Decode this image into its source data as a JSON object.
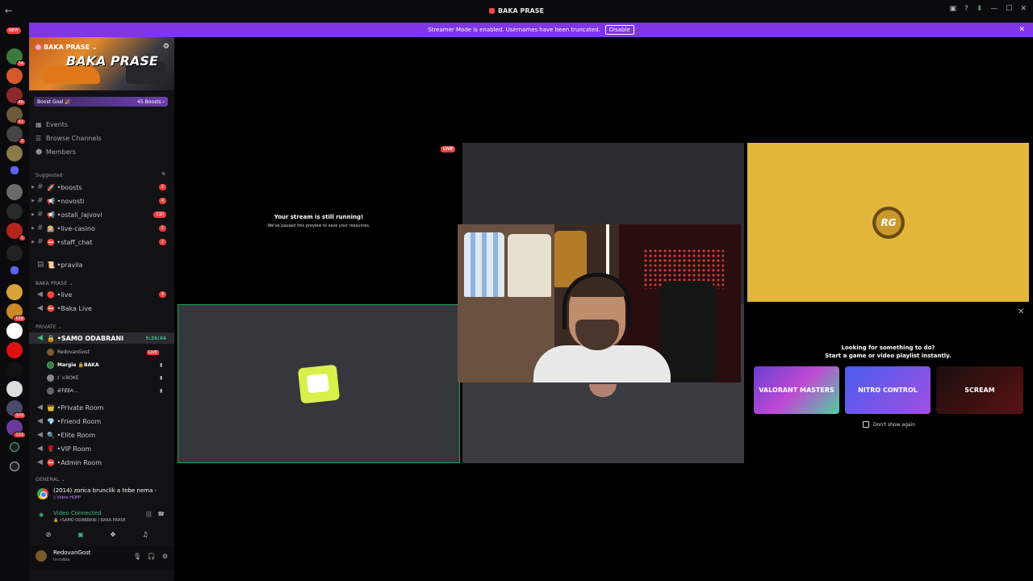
{
  "titlebar": {
    "back": "←",
    "title": "BAKA PRASE",
    "controls": [
      "▣",
      "?",
      "⬇",
      "—",
      "☐",
      "✕"
    ]
  },
  "banner": {
    "message": "Streamer Mode is enabled. Usernames have been truncated.",
    "button": "Disable",
    "close": "✕"
  },
  "rail": {
    "new_label": "NEW",
    "badges": [
      "34",
      "46",
      "41",
      "3",
      "1",
      "636",
      "303",
      "132"
    ]
  },
  "server": {
    "name": "BAKA PRASE ⌄",
    "banner_text": "BAKA PRASE",
    "boost_goal": "Boost Goal 🎉",
    "boost_count": "45 Boosts ›"
  },
  "nav": {
    "events": "Events",
    "browse": "Browse Channels",
    "members": "Members"
  },
  "sections": {
    "suggested": "Suggested",
    "baka_prase": "BAKA PRASE ⌄",
    "private": "PRIVATE ⌄",
    "general": "GENERAL ⌄"
  },
  "channels": {
    "suggested": [
      {
        "name": "🚀 •boosts",
        "count": "2"
      },
      {
        "name": "📢 •novosti",
        "count": "4"
      },
      {
        "name": "📢 •ostali_lajvovi",
        "count": "110"
      },
      {
        "name": "🎰 •live-casino",
        "count": "1"
      },
      {
        "name": "⛔ •staff_chat",
        "count": "2"
      }
    ],
    "rules": "📜 •pravila",
    "baka": [
      {
        "name": "🔴 •live",
        "count": "4"
      },
      {
        "name": "⛔ •Baka Live",
        "count": ""
      }
    ],
    "active": {
      "name": "🔒 •SAMO ODABRANI",
      "timer": "5:26:44"
    },
    "voice_users": [
      {
        "name": "RedovanGost",
        "live": "LIVE"
      },
      {
        "name": "Margie 🔒BAKA",
        "live": ""
      },
      {
        "name": "ﮐ ⚔BOKE",
        "live": ""
      },
      {
        "name": "₴₮ɆɆ₳…",
        "live": ""
      }
    ],
    "private": [
      "👑 •Private Room",
      "💎 •Friend Room",
      "🔍 •Elite Room",
      "🌹 •VIP Room",
      "⛔ •Admin Room"
    ]
  },
  "activity": {
    "title": "(2014) zorica brunclik a tebe nema - YouTub...",
    "sub": "▯ Vidite HOPP"
  },
  "voice": {
    "status": "Video Connected",
    "where": "🔒 •SAMO ODABRANI / BAKA PRASE"
  },
  "user": {
    "name": "RedovanGost",
    "status": "Invisible"
  },
  "stage": {
    "live_pill": "LIVE",
    "paused_title": "Your stream is still running!",
    "paused_sub": "We've paused this preview to save your resources.",
    "rg_logo": "RG"
  },
  "promo": {
    "line1": "Looking for something to do?",
    "line2": "Start a game or video playlist instantly.",
    "cards": [
      "VALORANT MASTERS",
      "NITRO CONTROL",
      "SCREAM"
    ],
    "dont_show": "Don't show again"
  },
  "colors": {
    "banner": "#7f36e6",
    "connected": "#43b581",
    "mention": "#f23f42",
    "gold_tile": "#e2b63b"
  }
}
